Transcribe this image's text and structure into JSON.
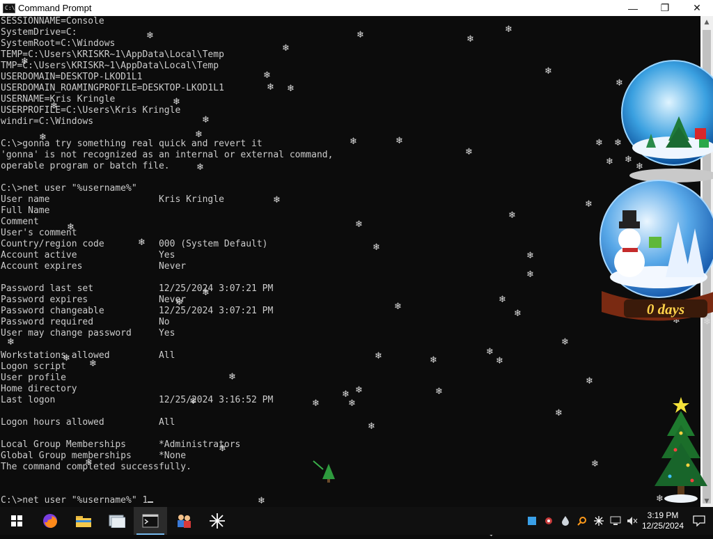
{
  "window": {
    "title": "Command Prompt",
    "app_icon_text": "C:\\",
    "minimize_glyph": "—",
    "maximize_glyph": "❐",
    "close_glyph": "✕"
  },
  "console": {
    "lines": [
      "SESSIONNAME=Console",
      "SystemDrive=C:",
      "SystemRoot=C:\\Windows",
      "TEMP=C:\\Users\\KRISKR~1\\AppData\\Local\\Temp",
      "TMP=C:\\Users\\KRISKR~1\\AppData\\Local\\Temp",
      "USERDOMAIN=DESKTOP-LKOD1L1",
      "USERDOMAIN_ROAMINGPROFILE=DESKTOP-LKOD1L1",
      "USERNAME=Kris Kringle",
      "USERPROFILE=C:\\Users\\Kris Kringle",
      "windir=C:\\Windows",
      "",
      "C:\\>gonna try something real quick and revert it",
      "'gonna' is not recognized as an internal or external command,",
      "operable program or batch file.",
      "",
      "C:\\>net user \"%username%\"",
      "User name                    Kris Kringle",
      "Full Name",
      "Comment",
      "User's comment",
      "Country/region code          000 (System Default)",
      "Account active               Yes",
      "Account expires              Never",
      "",
      "Password last set            12/25/2024 3:07:21 PM",
      "Password expires             Never",
      "Password changeable          12/25/2024 3:07:21 PM",
      "Password required            No",
      "User may change password     Yes",
      "",
      "Workstations allowed         All",
      "Logon script",
      "User profile",
      "Home directory",
      "Last logon                   12/25/2024 3:16:52 PM",
      "",
      "Logon hours allowed          All",
      "",
      "Local Group Memberships      *Administrators",
      "Global Group memberships     *None",
      "The command completed successfully.",
      "",
      ""
    ],
    "prompt_line": "C:\\>net user \"%username%\" 1"
  },
  "scrollbar": {
    "up_glyph": "▲",
    "down_glyph": "▼"
  },
  "desktop": {
    "globe_caption": "0 days"
  },
  "taskbar": {
    "items": [
      {
        "name": "start-button",
        "icon": "windows-logo-icon"
      },
      {
        "name": "firefox",
        "icon": "firefox-icon"
      },
      {
        "name": "file-explorer",
        "icon": "folder-icon"
      },
      {
        "name": "app-window",
        "icon": "window-app-icon"
      },
      {
        "name": "command-prompt",
        "icon": "cmd-icon"
      },
      {
        "name": "people-app",
        "icon": "people-icon"
      },
      {
        "name": "snowflake-app",
        "icon": "snowflake-icon"
      }
    ],
    "active_color": "#76b9ed",
    "clock_time": "3:19 PM",
    "clock_date": "12/25/2024",
    "tray_icons": [
      "square-app-icon",
      "gear-snow-icon",
      "drop-icon",
      "search-orange-icon",
      "snowflake-tray-icon",
      "network-icon",
      "volume-muted-icon"
    ]
  },
  "colors": {
    "console_bg": "#0c0c0c",
    "console_text": "#cccccc",
    "taskbar_bg": "#101010"
  }
}
